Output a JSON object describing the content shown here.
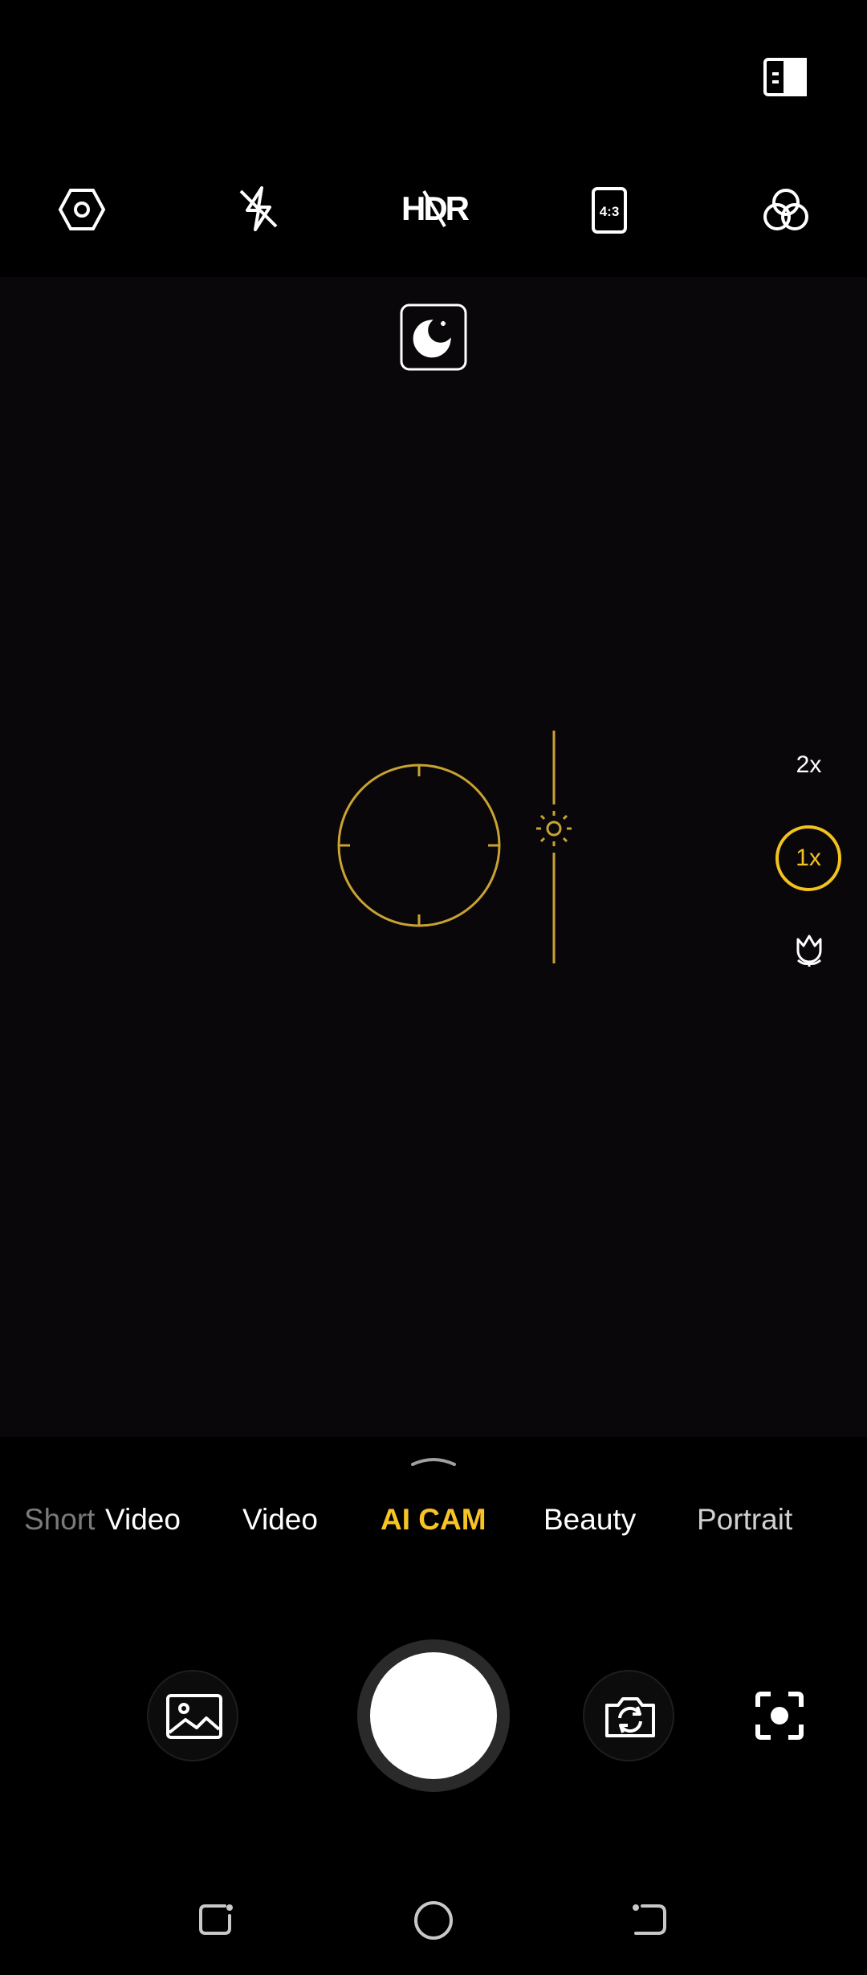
{
  "top_bar": {
    "icons": [
      "settings-icon",
      "flash-off-icon",
      "hdr-icon",
      "aspect-ratio-icon",
      "filter-icon"
    ],
    "aspect_ratio_label": "4:3",
    "hdr_label": "HDR",
    "guide_icon": "book-icon"
  },
  "viewfinder": {
    "night_mode_icon": "moon-icon",
    "focus_color": "#c9a331",
    "exposure_icon": "sun-icon"
  },
  "zoom": {
    "options": [
      "2x",
      "1x"
    ],
    "selected": "1x",
    "macro_icon": "flower-icon",
    "accent": "#f2c21e"
  },
  "modes": {
    "items": [
      "Short",
      "Video",
      "Video",
      "AI CAM",
      "Beauty",
      "Portrait"
    ],
    "active": "AI CAM",
    "active_color": "#f7c325"
  },
  "controls": {
    "gallery_icon": "image-icon",
    "switch_camera_icon": "camera-switch-icon",
    "scan_icon": "scan-icon"
  },
  "nav_bar": {
    "icons": [
      "recents-icon",
      "home-icon",
      "back-icon"
    ]
  }
}
